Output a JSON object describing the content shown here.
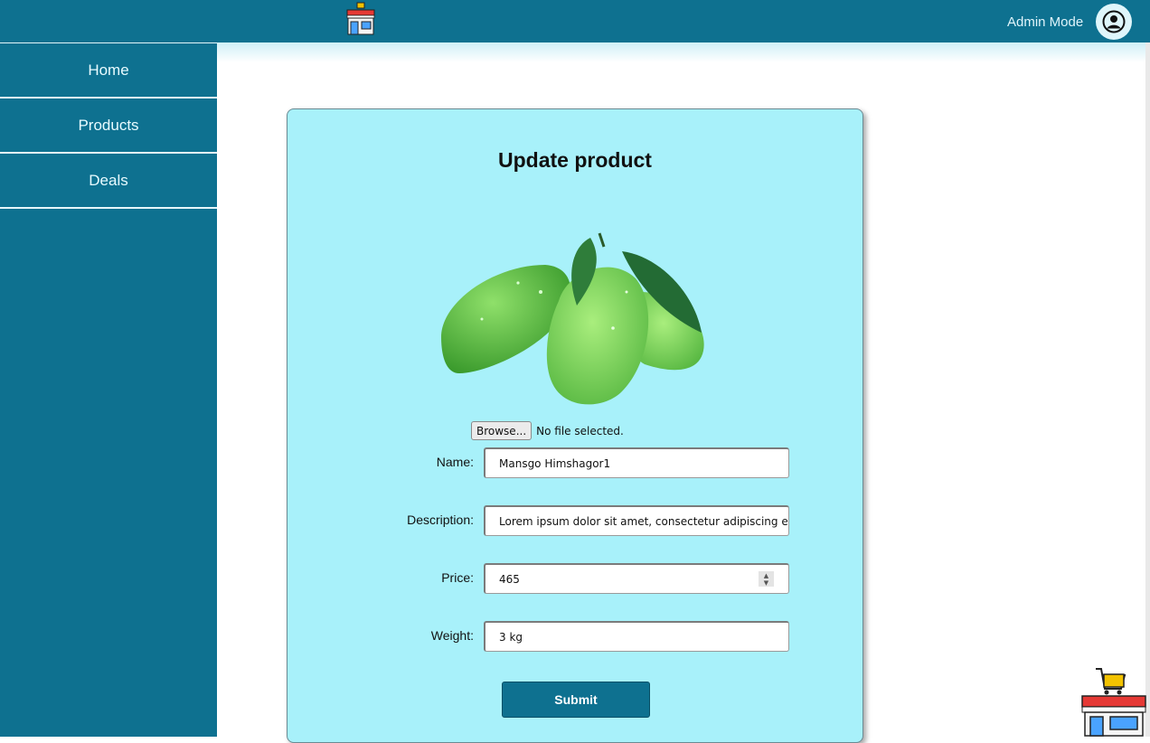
{
  "header": {
    "mode_label": "Admin Mode",
    "logo_icon": "store-icon",
    "avatar_icon": "user-circle-icon"
  },
  "sidebar": {
    "items": [
      {
        "label": "Home"
      },
      {
        "label": "Products"
      },
      {
        "label": "Deals"
      }
    ]
  },
  "form": {
    "title": "Update product",
    "image_icon": "mango-product-image",
    "file_button": "Browse...",
    "file_status": "No file selected.",
    "fields": [
      {
        "label": "Name:",
        "value": "Mansgo Himshagor1"
      },
      {
        "label": "Description:",
        "value": "Lorem ipsum dolor sit amet, consectetur adipiscing el"
      },
      {
        "label": "Price:",
        "value": "465"
      },
      {
        "label": "Weight:",
        "value": "3 kg"
      }
    ],
    "submit_label": "Submit"
  },
  "floating": {
    "cart_icon": "shop-cart-icon"
  },
  "colors": {
    "brand": "#0e7190",
    "card_bg": "#a8f1fa"
  }
}
